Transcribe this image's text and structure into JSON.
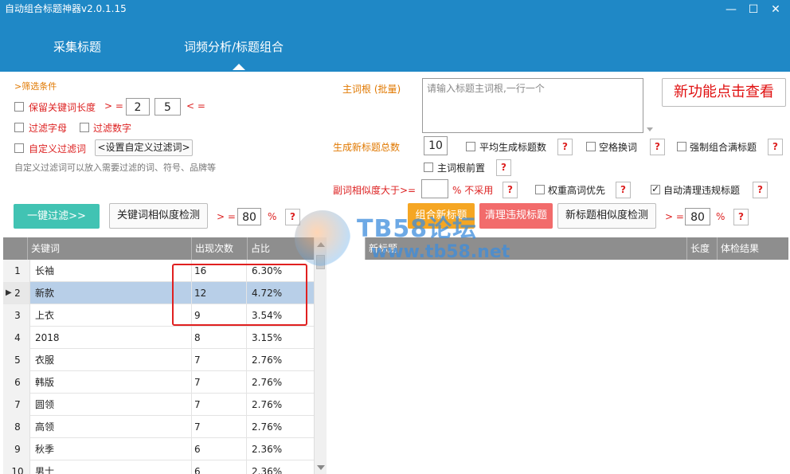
{
  "app": {
    "title": "自动组合标题神器v2.0.1.15"
  },
  "window_controls": {
    "minimize": "—",
    "maximize": "☐",
    "close": "✕"
  },
  "tabs": [
    {
      "label": "采集标题"
    },
    {
      "label": "词频分析/标题组合",
      "active": true
    }
  ],
  "filter": {
    "section_title": ">筛选条件",
    "keep_len_label": "保留关键词长度",
    "ge": "> =",
    "min_len": "2",
    "max_len": "5",
    "le": "< =",
    "filter_letters": "过滤字母",
    "filter_digits": "过滤数字",
    "custom_filter": "自定义过滤词",
    "set_custom_button": "<设置自定义过滤词>",
    "hint": "自定义过滤词可以放入需要过滤的词、符号、品牌等"
  },
  "main_root": {
    "label": "主词根 (批量)",
    "placeholder": "请输入标题主词根,一行一个"
  },
  "new_feature_button": "新功能点击查看",
  "generate": {
    "total_label": "生成新标题总数",
    "total_value": "10",
    "average_label": "平均生成标题数",
    "space_label": "空格换词",
    "force_full_label": "强制组合满标题",
    "root_front_label": "主词根前置"
  },
  "similarity": {
    "label": "副词相似度大于>=",
    "value": "",
    "not_used": "% 不采用",
    "weight_label": "权重高词优先",
    "auto_clean_label": "自动清理违规标题"
  },
  "actions": {
    "one_click_filter": "一键过滤>>",
    "kw_similarity_check": "关键词相似度检测",
    "ge": "> =",
    "kw_sim_value": "80",
    "percent": "%",
    "combine": "组合新标题",
    "clean_violations": "清理违规标题",
    "new_title_check": "新标题相似度检测",
    "new_sim_value": "80",
    "q": "?"
  },
  "keyword_table": {
    "columns": [
      "关键词",
      "出现次数",
      "占比"
    ],
    "rows": [
      {
        "n": "1",
        "kw": "长袖",
        "count": "16",
        "pct": "6.30%"
      },
      {
        "n": "2",
        "kw": "新款",
        "count": "12",
        "pct": "4.72%"
      },
      {
        "n": "3",
        "kw": "上衣",
        "count": "9",
        "pct": "3.54%"
      },
      {
        "n": "4",
        "kw": "2018",
        "count": "8",
        "pct": "3.15%"
      },
      {
        "n": "5",
        "kw": "衣服",
        "count": "7",
        "pct": "2.76%"
      },
      {
        "n": "6",
        "kw": "韩版",
        "count": "7",
        "pct": "2.76%"
      },
      {
        "n": "7",
        "kw": "圆领",
        "count": "7",
        "pct": "2.76%"
      },
      {
        "n": "8",
        "kw": "高领",
        "count": "7",
        "pct": "2.76%"
      },
      {
        "n": "9",
        "kw": "秋季",
        "count": "6",
        "pct": "2.36%"
      },
      {
        "n": "10",
        "kw": "男士",
        "count": "6",
        "pct": "2.36%"
      }
    ],
    "selected_row": 2
  },
  "title_table": {
    "columns": [
      "新标题",
      "长度",
      "体检结果"
    ]
  },
  "watermark": {
    "big": "TB58论坛",
    "url": "www.tb58.net"
  },
  "colors": {
    "titlebar": "#1f88c6",
    "filter_btn": "#41c3b3",
    "combine_btn": "#f5a623",
    "clean_btn": "#f26b6b",
    "accent_text": "#e07800"
  }
}
